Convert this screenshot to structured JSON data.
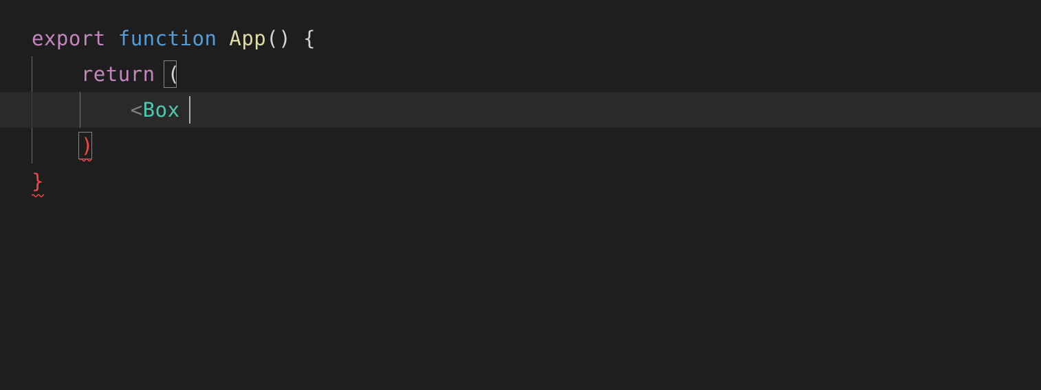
{
  "editor": {
    "theme": "dark-plus",
    "background": "#1e1e1e",
    "current_line_bg": "#2a2a2a",
    "cursor_color": "#aeafad",
    "bracket_match_border": "#888888",
    "error_color": "#f44747",
    "colors": {
      "keyword_export": "#c586c0",
      "keyword_function": "#569cd6",
      "function_name": "#dcdcaa",
      "punctuation": "#d4d4d4",
      "keyword_return": "#c586c0",
      "jsx_component": "#4ec9b0",
      "jsx_bracket": "#808080"
    },
    "lines": [
      {
        "tokens": [
          {
            "t": "export",
            "cls": "kw-export"
          },
          {
            "t": " ",
            "cls": "punct"
          },
          {
            "t": "function",
            "cls": "kw-function"
          },
          {
            "t": " ",
            "cls": "punct"
          },
          {
            "t": "App",
            "cls": "fn-name"
          },
          {
            "t": "()",
            "cls": "punct"
          },
          {
            "t": " ",
            "cls": "punct"
          },
          {
            "t": "{",
            "cls": "punct"
          }
        ],
        "current": false,
        "guides": []
      },
      {
        "tokens": [
          {
            "t": "    ",
            "cls": "punct"
          },
          {
            "t": "return",
            "cls": "kw-return"
          },
          {
            "t": " ",
            "cls": "punct"
          },
          {
            "t": "(",
            "cls": "punct"
          }
        ],
        "current": false,
        "guides": [
          0
        ],
        "bracket_match_col": 11
      },
      {
        "tokens": [
          {
            "t": "        ",
            "cls": "punct"
          },
          {
            "t": "<",
            "cls": "jsx-angle"
          },
          {
            "t": "Box",
            "cls": "jsx-name"
          },
          {
            "t": " ",
            "cls": "punct"
          }
        ],
        "current": true,
        "guides": [
          0,
          1
        ],
        "cursor_col": 13
      },
      {
        "tokens": [
          {
            "t": "    ",
            "cls": "punct"
          },
          {
            "t": ")",
            "cls": "error"
          }
        ],
        "current": false,
        "guides": [
          0
        ],
        "error_squiggle": {
          "col": 4,
          "len": 1
        },
        "bracket_match_col": 4
      },
      {
        "tokens": [
          {
            "t": "}",
            "cls": "error"
          }
        ],
        "current": false,
        "guides": [],
        "error_squiggle": {
          "col": 0,
          "len": 1
        }
      }
    ]
  }
}
